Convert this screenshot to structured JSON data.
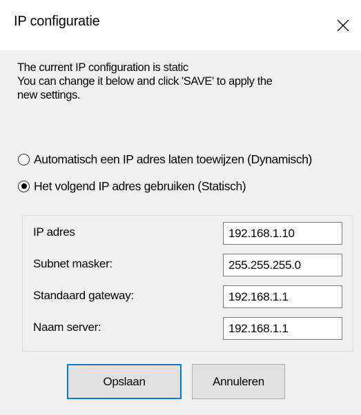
{
  "window": {
    "title": "IP configuratie",
    "close_icon": "close-icon"
  },
  "info": {
    "line1": "The current IP configuration is static",
    "line2": "You can change it below and click 'SAVE' to apply the",
    "line3": "new settings."
  },
  "options": {
    "dynamic": {
      "label": "Automatisch een IP adres laten toewijzen (Dynamisch)",
      "selected": false
    },
    "static": {
      "label": "Het volgend IP adres gebruiken (Statisch)",
      "selected": true
    }
  },
  "fields": {
    "ip": {
      "label": "IP adres",
      "value": "192.168.1.10"
    },
    "subnet": {
      "label": "Subnet masker:",
      "value": "255.255.255.0"
    },
    "gateway": {
      "label": "Standaard gateway:",
      "value": "192.168.1.1"
    },
    "dns": {
      "label": "Naam server:",
      "value": "192.168.1.1"
    }
  },
  "buttons": {
    "save": "Opslaan",
    "cancel": "Annuleren"
  },
  "colors": {
    "dialog_bg": "#f0f0f0",
    "titlebar_bg": "#ffffff",
    "focus_accent": "#0078d7"
  }
}
